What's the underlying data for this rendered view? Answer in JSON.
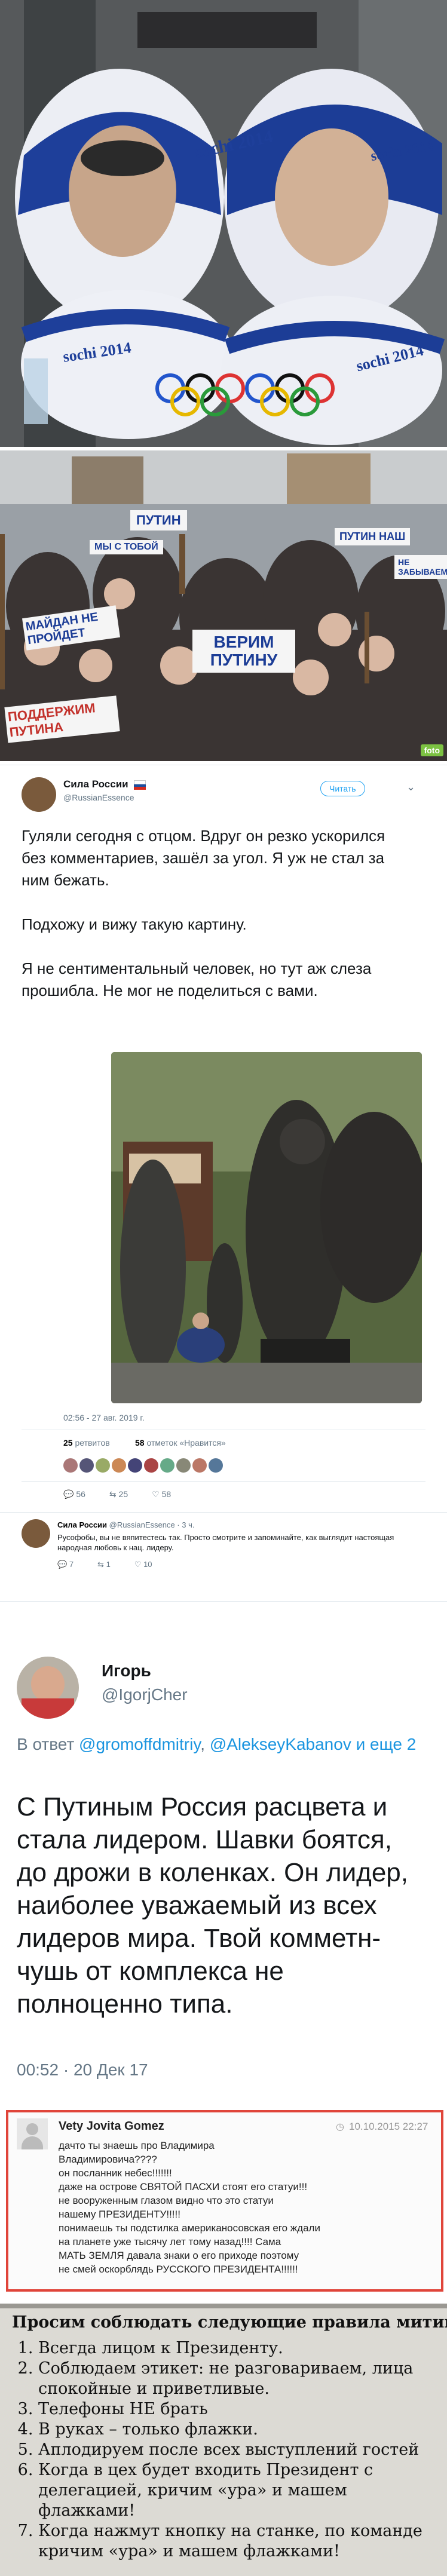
{
  "photo1": {
    "scene": "",
    "tags": [
      "sochi 2014",
      "sochi 2014",
      "sochi 2014",
      "sochi 2014"
    ]
  },
  "photo2": {
    "signs": [
      "ПУТИН",
      "МЫ С ТОБОЙ",
      "ВЕРИМ ПУТИНУ",
      "МАЙДАН НЕ ПРОЙДЕТ",
      "ПОДДЕРЖИМ ПУТИНА",
      "ПУТИН НАШ",
      "НЕ ЗАБЫВАЕМ"
    ],
    "watermark": "foto"
  },
  "tweet1": {
    "author": "Сила России",
    "handle": "@RussianEssence",
    "follow_label": "Читать",
    "text_p1": "Гуляли сегодня с отцом. Вдруг он резко ускорился без комментариев, зашёл за угол. Я уж не стал за ним бежать.",
    "text_p2": "Подхожу и вижу такую картину.",
    "text_p3": "Я не сентиментальный человек, но тут аж слеза прошибла. Не мог не поделиться с вами.",
    "timestamp": "02:56 - 27 авг. 2019 г.",
    "retweets_count": "25",
    "retweets_label": "ретвитов",
    "likes_count": "58",
    "likes_label": "отметок «Нравится»",
    "actions": {
      "reply": "56",
      "retweet": "25",
      "like": "58"
    }
  },
  "tweet2": {
    "author": "Сила России",
    "handle": "@RussianEssence · 3 ч.",
    "text": "Русофобы, вы не вяпитестесь так. Просто смотрите и запоминайте, как выглядит настоящая народная любовь к нац. лидеру.",
    "actions": {
      "reply": "7",
      "retweet": "1",
      "like": "10"
    }
  },
  "tweet3": {
    "author": "Игорь",
    "handle": "@IgorjCher",
    "reply_prefix": "В ответ",
    "reply_to_1": "@gromoffdmitriy",
    "reply_to_2": "@AlekseyKabanov",
    "reply_suffix": "и еще 2",
    "text": "С  Путиным Россия расцвета и стала лидером.  Шавки боятся, до дрожи в коленках.  Он лидер, наиболее уважаемый из всех лидеров мира.  Твой комметн-чушь от комплекса не полноценно типа.",
    "timestamp": "00:52 · 20 Дек 17"
  },
  "comment": {
    "author": "Vety Jovita Gomez",
    "date": "10.10.2015 22:27",
    "lines": [
      "дачто ты знаешь про Владимира",
      "Владимировича????",
      "он посланник небес!!!!!!!",
      "даже на острове СВЯТОЙ ПАСХИ стоят его статуи!!!",
      "не вооруженным глазом видно что это статуи",
      "нашему ПРЕЗИДЕНТУ!!!!!",
      "понимаешь ты подстилка американосовская его ждали",
      "на планете уже тысячу лет тому назад!!!! Сама",
      "МАТЬ ЗЕМЛЯ давала знаки о его приходе поэтому",
      "не смей оскорблядь РУССКОГО ПРЕЗИДЕНТА!!!!!!"
    ]
  },
  "rules": {
    "title": "Просим соблюдать следующие правила митинга:",
    "items": [
      "Всегда лицом к Президенту.",
      "Соблюдаем этикет: не разговариваем, лица спокойные и приветливые.",
      "Телефоны НЕ брать",
      "В руках – только флажки.",
      "Аплодируем после всех выступлений гостей",
      "Когда в цех будет входить Президент с делегацией, кричим «ура» и машем флажками!",
      "Когда нажмут кнопку на станке, по команде кричим «ура» и машем флажками!"
    ]
  },
  "colors": {
    "twitter_blue": "#1da1f2",
    "red_border": "#e0453a"
  }
}
